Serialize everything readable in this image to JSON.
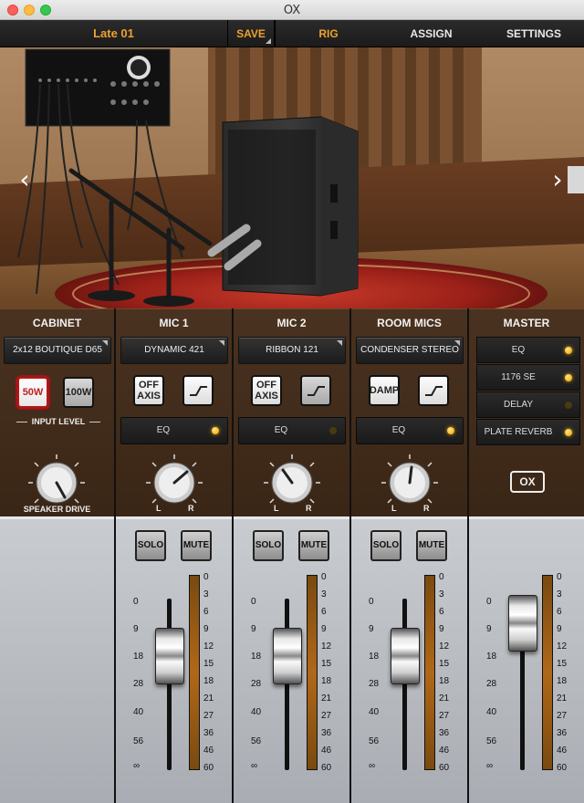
{
  "window": {
    "title": "OX"
  },
  "topbar": {
    "preset": "Late 01",
    "save": "SAVE",
    "tabs": [
      "RIG",
      "ASSIGN",
      "SETTINGS"
    ],
    "active_tab": "RIG"
  },
  "colors": {
    "accent": "#f0a030",
    "led_on": "#f0a000",
    "led_off": "#4a3a10"
  },
  "scene": {
    "prev_icon": "chevron-left-icon",
    "next_icon": "chevron-right-icon"
  },
  "cabinet": {
    "title": "CABINET",
    "model": "2x12 BOUTIQUE D65",
    "btn_50w": "50W",
    "btn_100w": "100W",
    "selected_power": "50W",
    "input_level": "INPUT LEVEL",
    "drive_label": "SPEAKER DRIVE"
  },
  "mic1": {
    "title": "MIC 1",
    "model": "DYNAMIC 421",
    "axis_btn": "OFF\nAXIS",
    "eq": "EQ",
    "eq_on": true,
    "pan_l": "L",
    "pan_r": "R",
    "solo": "SOLO",
    "mute": "MUTE"
  },
  "mic2": {
    "title": "MIC 2",
    "model": "RIBBON 121",
    "axis_btn": "OFF\nAXIS",
    "eq": "EQ",
    "eq_on": false,
    "pan_l": "L",
    "pan_r": "R",
    "solo": "SOLO",
    "mute": "MUTE"
  },
  "room": {
    "title": "ROOM MICS",
    "model": "CONDENSER STEREO",
    "damp_btn": "DAMP",
    "eq": "EQ",
    "eq_on": true,
    "pan_l": "L",
    "pan_r": "R",
    "solo": "SOLO",
    "mute": "MUTE"
  },
  "master": {
    "title": "MASTER",
    "fx": [
      {
        "label": "EQ",
        "on": true
      },
      {
        "label": "1176 SE",
        "on": true
      },
      {
        "label": "DELAY",
        "on": false
      },
      {
        "label": "PLATE REVERB",
        "on": true
      }
    ],
    "logo": "OX"
  },
  "fader_scale": [
    "0",
    "9",
    "18",
    "28",
    "40",
    "56",
    "∞"
  ],
  "meter_scale": [
    "0",
    "3",
    "6",
    "9",
    "12",
    "15",
    "18",
    "21",
    "27",
    "36",
    "46",
    "60"
  ]
}
